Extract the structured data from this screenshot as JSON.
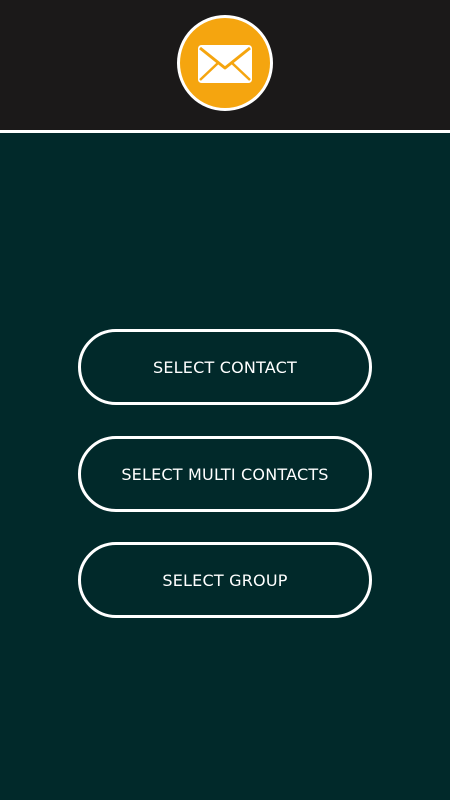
{
  "header": {
    "logo_icon": "envelope-icon",
    "background": "#1b1919",
    "logo_color": "#f5a50f"
  },
  "main": {
    "background": "#01292a",
    "buttons": [
      {
        "label": "SELECT CONTACT"
      },
      {
        "label": "SELECT MULTI CONTACTS"
      },
      {
        "label": "SELECT GROUP"
      }
    ]
  }
}
